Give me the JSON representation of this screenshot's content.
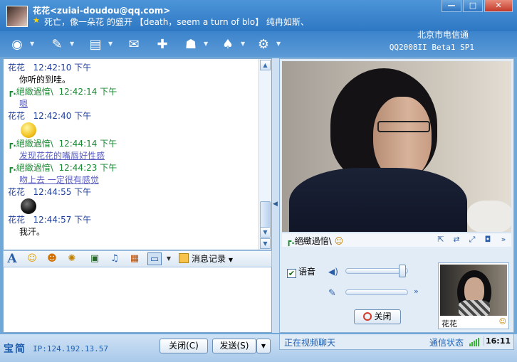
{
  "title": {
    "contact": "花花<zuiai-doudou@qq.com>",
    "signature": "死亡，像一朵花 的盛开 【death，seem a turn of blo】 纯冉如斯、",
    "window_buttons": [
      "—",
      "□",
      "✕"
    ]
  },
  "header": {
    "isp": "北京市电信通",
    "version": "QQ2008II Beta1 SP1"
  },
  "toolbar": {
    "tools": [
      {
        "icon": "video-call-icon"
      },
      {
        "icon": "voice-call-icon"
      },
      {
        "icon": "send-file-icon"
      },
      {
        "icon": "send-mail-icon"
      },
      {
        "icon": "add-app-icon"
      },
      {
        "icon": "group-icon"
      },
      {
        "icon": "games-icon"
      },
      {
        "icon": "settings-icon"
      }
    ]
  },
  "chat": {
    "messages": [
      {
        "sender": "花花",
        "time": "12:42:10 下午",
        "text": "你听的到哇。",
        "self": false
      },
      {
        "sender": "絕緻過愔\\",
        "time": "12:42:14 下午",
        "text": "嗯",
        "self": true
      },
      {
        "sender": "花花",
        "time": "12:42:40 下午",
        "emoji": "yellow-face-emoji",
        "self": false
      },
      {
        "sender": "絕緻過愔\\",
        "time": "12:44:14 下午",
        "text": "发现花花的嘴唇好性感",
        "self": true
      },
      {
        "sender": "絕緻過愔\\",
        "time": "12:44:23 下午",
        "text": "吻上去 一定很有感觉",
        "self": true
      },
      {
        "sender": "花花",
        "time": "12:44:55 下午",
        "emoji": "black-face-emoji",
        "self": false
      },
      {
        "sender": "花花",
        "time": "12:44:57 下午",
        "text": "我汗。",
        "self": false
      }
    ]
  },
  "format_bar": {
    "font_label": "A",
    "history_label": "消息记录"
  },
  "bottom": {
    "brand": "宝简",
    "ip": "IP:124.192.13.57",
    "close_label": "关闭(C)",
    "send_label": "发送(S)"
  },
  "video": {
    "remote_name": "絕緻過愔\\",
    "voice_label": "语音",
    "stop_label": "关闭",
    "local_name": "花花",
    "status": "正在视频聊天",
    "net_label": "通信状态",
    "clock": "16:11"
  }
}
